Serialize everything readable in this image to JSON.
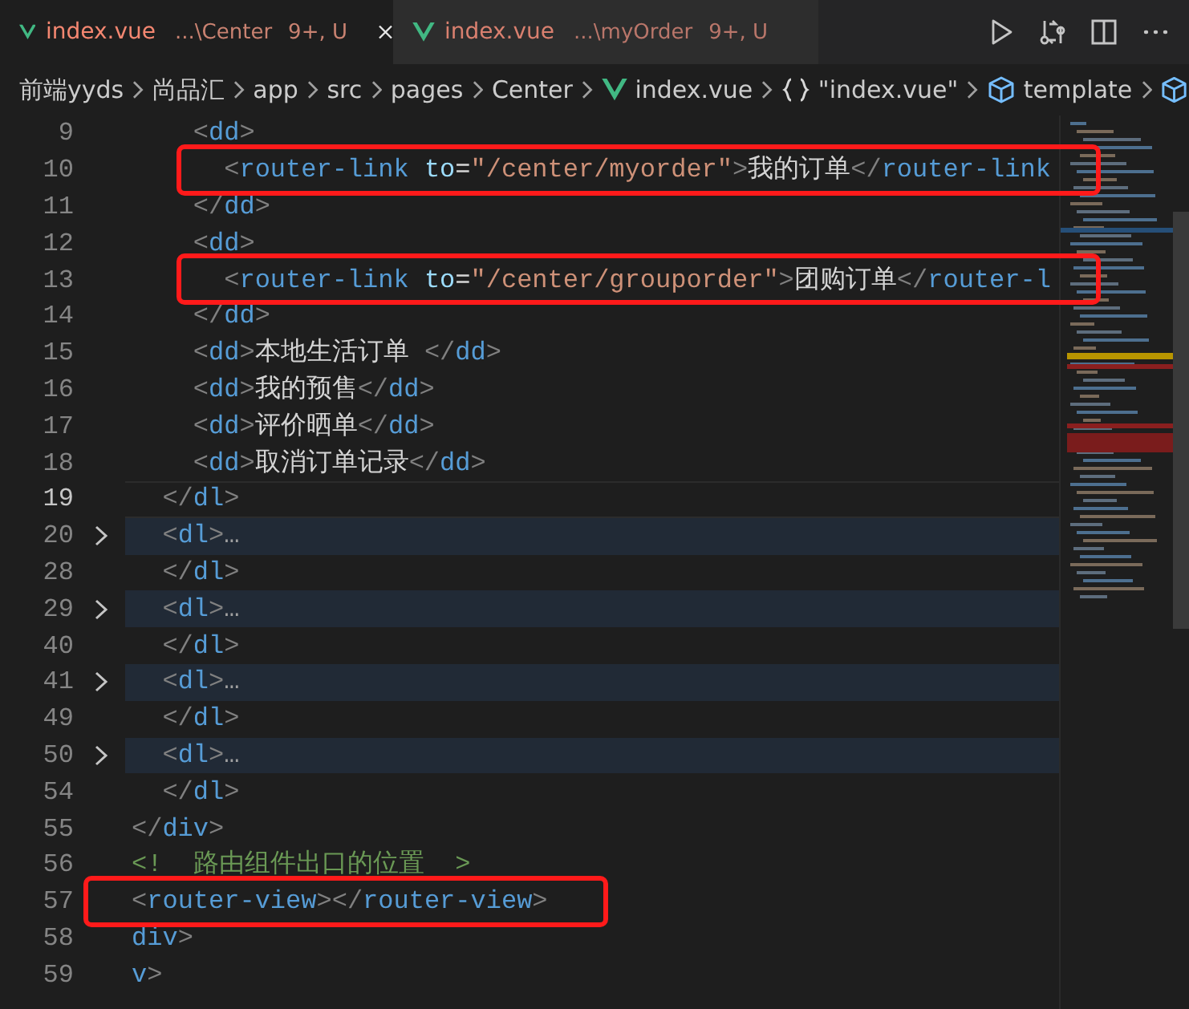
{
  "tabs": [
    {
      "name": "index.vue",
      "path": "...\\Center",
      "status": "9+, U",
      "selected": true,
      "closable": true
    },
    {
      "name": "index.vue",
      "path": "...\\myOrder",
      "status": "9+, U",
      "selected": false,
      "closable": false
    }
  ],
  "breadcrumb": [
    {
      "label": "前端yyds"
    },
    {
      "label": "尚品汇"
    },
    {
      "label": "app"
    },
    {
      "label": "src"
    },
    {
      "label": "pages"
    },
    {
      "label": "Center"
    },
    {
      "label": "index.vue",
      "kind": "vue"
    },
    {
      "label": "\"index.vue\"",
      "kind": "braces"
    },
    {
      "label": "template",
      "kind": "cube"
    },
    {
      "kind": "cube"
    }
  ],
  "lines": [
    {
      "number": "9",
      "folded": false,
      "current": false,
      "highlighted": false,
      "tokens": [
        {
          "kind": "punct",
          "text": "    <"
        },
        {
          "kind": "tag",
          "text": "dd"
        },
        {
          "kind": "punct",
          "text": ">"
        }
      ]
    },
    {
      "number": "10",
      "folded": false,
      "current": false,
      "highlighted": true,
      "tokens": [
        {
          "kind": "punct",
          "text": "      <"
        },
        {
          "kind": "tag",
          "text": "router-link"
        },
        {
          "kind": "attr",
          "text": " to"
        },
        {
          "kind": "plain",
          "text": "="
        },
        {
          "kind": "string",
          "text": "\"/center/myorder\""
        },
        {
          "kind": "punct",
          "text": ">"
        },
        {
          "kind": "plain",
          "text": "我的订单"
        },
        {
          "kind": "punct",
          "text": "</"
        },
        {
          "kind": "tag",
          "text": "router-link"
        }
      ]
    },
    {
      "number": "11",
      "folded": false,
      "current": false,
      "highlighted": false,
      "tokens": [
        {
          "kind": "punct",
          "text": "    </"
        },
        {
          "kind": "tag",
          "text": "dd"
        },
        {
          "kind": "punct",
          "text": ">"
        }
      ]
    },
    {
      "number": "12",
      "folded": false,
      "current": false,
      "highlighted": false,
      "tokens": [
        {
          "kind": "punct",
          "text": "    <"
        },
        {
          "kind": "tag",
          "text": "dd"
        },
        {
          "kind": "punct",
          "text": ">"
        }
      ]
    },
    {
      "number": "13",
      "folded": false,
      "current": false,
      "highlighted": true,
      "tokens": [
        {
          "kind": "punct",
          "text": "      <"
        },
        {
          "kind": "tag",
          "text": "router-link"
        },
        {
          "kind": "attr",
          "text": " to"
        },
        {
          "kind": "plain",
          "text": "="
        },
        {
          "kind": "string",
          "text": "\"/center/grouporder\""
        },
        {
          "kind": "punct",
          "text": ">"
        },
        {
          "kind": "plain",
          "text": "团购订单"
        },
        {
          "kind": "punct",
          "text": "</"
        },
        {
          "kind": "tag",
          "text": "router-l"
        }
      ]
    },
    {
      "number": "14",
      "folded": false,
      "current": false,
      "highlighted": false,
      "tokens": [
        {
          "kind": "punct",
          "text": "    </"
        },
        {
          "kind": "tag",
          "text": "dd"
        },
        {
          "kind": "punct",
          "text": ">"
        }
      ]
    },
    {
      "number": "15",
      "folded": false,
      "current": false,
      "highlighted": false,
      "tokens": [
        {
          "kind": "punct",
          "text": "    <"
        },
        {
          "kind": "tag",
          "text": "dd"
        },
        {
          "kind": "punct",
          "text": ">"
        },
        {
          "kind": "plain",
          "text": "本地生活订单 "
        },
        {
          "kind": "punct",
          "text": "</"
        },
        {
          "kind": "tag",
          "text": "dd"
        },
        {
          "kind": "punct",
          "text": ">"
        }
      ]
    },
    {
      "number": "16",
      "folded": false,
      "current": false,
      "highlighted": false,
      "tokens": [
        {
          "kind": "punct",
          "text": "    <"
        },
        {
          "kind": "tag",
          "text": "dd"
        },
        {
          "kind": "punct",
          "text": ">"
        },
        {
          "kind": "plain",
          "text": "我的预售"
        },
        {
          "kind": "punct",
          "text": "</"
        },
        {
          "kind": "tag",
          "text": "dd"
        },
        {
          "kind": "punct",
          "text": ">"
        }
      ]
    },
    {
      "number": "17",
      "folded": false,
      "current": false,
      "highlighted": false,
      "tokens": [
        {
          "kind": "punct",
          "text": "    <"
        },
        {
          "kind": "tag",
          "text": "dd"
        },
        {
          "kind": "punct",
          "text": ">"
        },
        {
          "kind": "plain",
          "text": "评价晒单"
        },
        {
          "kind": "punct",
          "text": "</"
        },
        {
          "kind": "tag",
          "text": "dd"
        },
        {
          "kind": "punct",
          "text": ">"
        }
      ]
    },
    {
      "number": "18",
      "folded": false,
      "current": false,
      "highlighted": false,
      "tokens": [
        {
          "kind": "punct",
          "text": "    <"
        },
        {
          "kind": "tag",
          "text": "dd"
        },
        {
          "kind": "punct",
          "text": ">"
        },
        {
          "kind": "plain",
          "text": "取消订单记录"
        },
        {
          "kind": "punct",
          "text": "</"
        },
        {
          "kind": "tag",
          "text": "dd"
        },
        {
          "kind": "punct",
          "text": ">"
        }
      ]
    },
    {
      "number": "19",
      "folded": false,
      "current": true,
      "highlighted": false,
      "tokens": [
        {
          "kind": "punct",
          "text": "  </"
        },
        {
          "kind": "tag",
          "text": "dl"
        },
        {
          "kind": "punct",
          "text": ">"
        }
      ]
    },
    {
      "number": "20",
      "folded": true,
      "current": false,
      "highlighted": false,
      "tokens": [
        {
          "kind": "punct",
          "text": "  <"
        },
        {
          "kind": "tag",
          "text": "dl"
        },
        {
          "kind": "punct",
          "text": ">"
        },
        {
          "kind": "ellipsis",
          "text": "…"
        }
      ]
    },
    {
      "number": "28",
      "folded": false,
      "current": false,
      "highlighted": false,
      "tokens": [
        {
          "kind": "punct",
          "text": "  </"
        },
        {
          "kind": "tag",
          "text": "dl"
        },
        {
          "kind": "punct",
          "text": ">"
        }
      ]
    },
    {
      "number": "29",
      "folded": true,
      "current": false,
      "highlighted": false,
      "tokens": [
        {
          "kind": "punct",
          "text": "  <"
        },
        {
          "kind": "tag",
          "text": "dl"
        },
        {
          "kind": "punct",
          "text": ">"
        },
        {
          "kind": "ellipsis",
          "text": "…"
        }
      ]
    },
    {
      "number": "40",
      "folded": false,
      "current": false,
      "highlighted": false,
      "tokens": [
        {
          "kind": "punct",
          "text": "  </"
        },
        {
          "kind": "tag",
          "text": "dl"
        },
        {
          "kind": "punct",
          "text": ">"
        }
      ]
    },
    {
      "number": "41",
      "folded": true,
      "current": false,
      "highlighted": false,
      "tokens": [
        {
          "kind": "punct",
          "text": "  <"
        },
        {
          "kind": "tag",
          "text": "dl"
        },
        {
          "kind": "punct",
          "text": ">"
        },
        {
          "kind": "ellipsis",
          "text": "…"
        }
      ]
    },
    {
      "number": "49",
      "folded": false,
      "current": false,
      "highlighted": false,
      "tokens": [
        {
          "kind": "punct",
          "text": "  </"
        },
        {
          "kind": "tag",
          "text": "dl"
        },
        {
          "kind": "punct",
          "text": ">"
        }
      ]
    },
    {
      "number": "50",
      "folded": true,
      "current": false,
      "highlighted": false,
      "tokens": [
        {
          "kind": "punct",
          "text": "  <"
        },
        {
          "kind": "tag",
          "text": "dl"
        },
        {
          "kind": "punct",
          "text": ">"
        },
        {
          "kind": "ellipsis",
          "text": "…"
        }
      ]
    },
    {
      "number": "54",
      "folded": false,
      "current": false,
      "highlighted": false,
      "tokens": [
        {
          "kind": "punct",
          "text": "  </"
        },
        {
          "kind": "tag",
          "text": "dl"
        },
        {
          "kind": "punct",
          "text": ">"
        }
      ]
    },
    {
      "number": "55",
      "folded": false,
      "current": false,
      "highlighted": false,
      "tokens": [
        {
          "kind": "punct",
          "text": "</"
        },
        {
          "kind": "tag",
          "text": "div"
        },
        {
          "kind": "punct",
          "text": ">"
        }
      ]
    },
    {
      "number": "56",
      "folded": false,
      "current": false,
      "highlighted": false,
      "tokens": [
        {
          "kind": "comment",
          "text": "<!  路由组件出口的位置  >"
        }
      ]
    },
    {
      "number": "57",
      "folded": false,
      "current": false,
      "highlighted": true,
      "tokens": [
        {
          "kind": "punct",
          "text": "<"
        },
        {
          "kind": "tag",
          "text": "router-view"
        },
        {
          "kind": "punct",
          "text": "></"
        },
        {
          "kind": "tag",
          "text": "router-view"
        },
        {
          "kind": "punct",
          "text": ">"
        }
      ]
    },
    {
      "number": "58",
      "folded": false,
      "current": false,
      "highlighted": false,
      "tokens": [
        {
          "kind": "tag",
          "text": "div"
        },
        {
          "kind": "punct",
          "text": ">"
        }
      ]
    },
    {
      "number": "59",
      "folded": false,
      "current": false,
      "highlighted": false,
      "tokens": [
        {
          "kind": "tag",
          "text": "v"
        },
        {
          "kind": "punct",
          "text": ">"
        }
      ]
    }
  ]
}
